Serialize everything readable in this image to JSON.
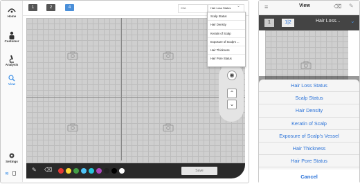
{
  "nav": {
    "home": "Home",
    "customer": "Customer",
    "analysis": "Analysis",
    "view": "View",
    "settings": "Settings"
  },
  "topbar": {
    "layout_buttons": [
      "1",
      "2",
      "4"
    ],
    "zoom_select": "X0A",
    "type_select": "Hair Loss Status"
  },
  "dropdown_items": [
    "Scalp Status",
    "Hair Density",
    "Keratin of Scalp",
    "Exposure of Scalp's ...",
    "Hair Thickness",
    "Hair Pore Status"
  ],
  "bottom": {
    "save_label": "Save",
    "swatches": [
      "#e53935",
      "#fdd835",
      "#43a047",
      "#4fc3f7",
      "#26c6da",
      "#ab47bc",
      "#222222",
      "#000000",
      "#ffffff"
    ]
  },
  "side_controls": {
    "target_glyph": "◉",
    "up_glyph": "⌃",
    "down_glyph": "⌄"
  },
  "phone": {
    "title": "View",
    "layout_buttons": [
      "1",
      "1|2"
    ],
    "select_value": "Hair Loss...",
    "sheet_items": [
      "Hair Loss Status",
      "Scalp Status",
      "Hair Density",
      "Keratin of Scalp",
      "Exposure of Scalp's Vessel",
      "Hair Thickness",
      "Hair Pore Status"
    ],
    "cancel": "Cancel"
  },
  "colors": {
    "accent": "#3a8ee6",
    "ios_blue": "#2a72d8"
  }
}
